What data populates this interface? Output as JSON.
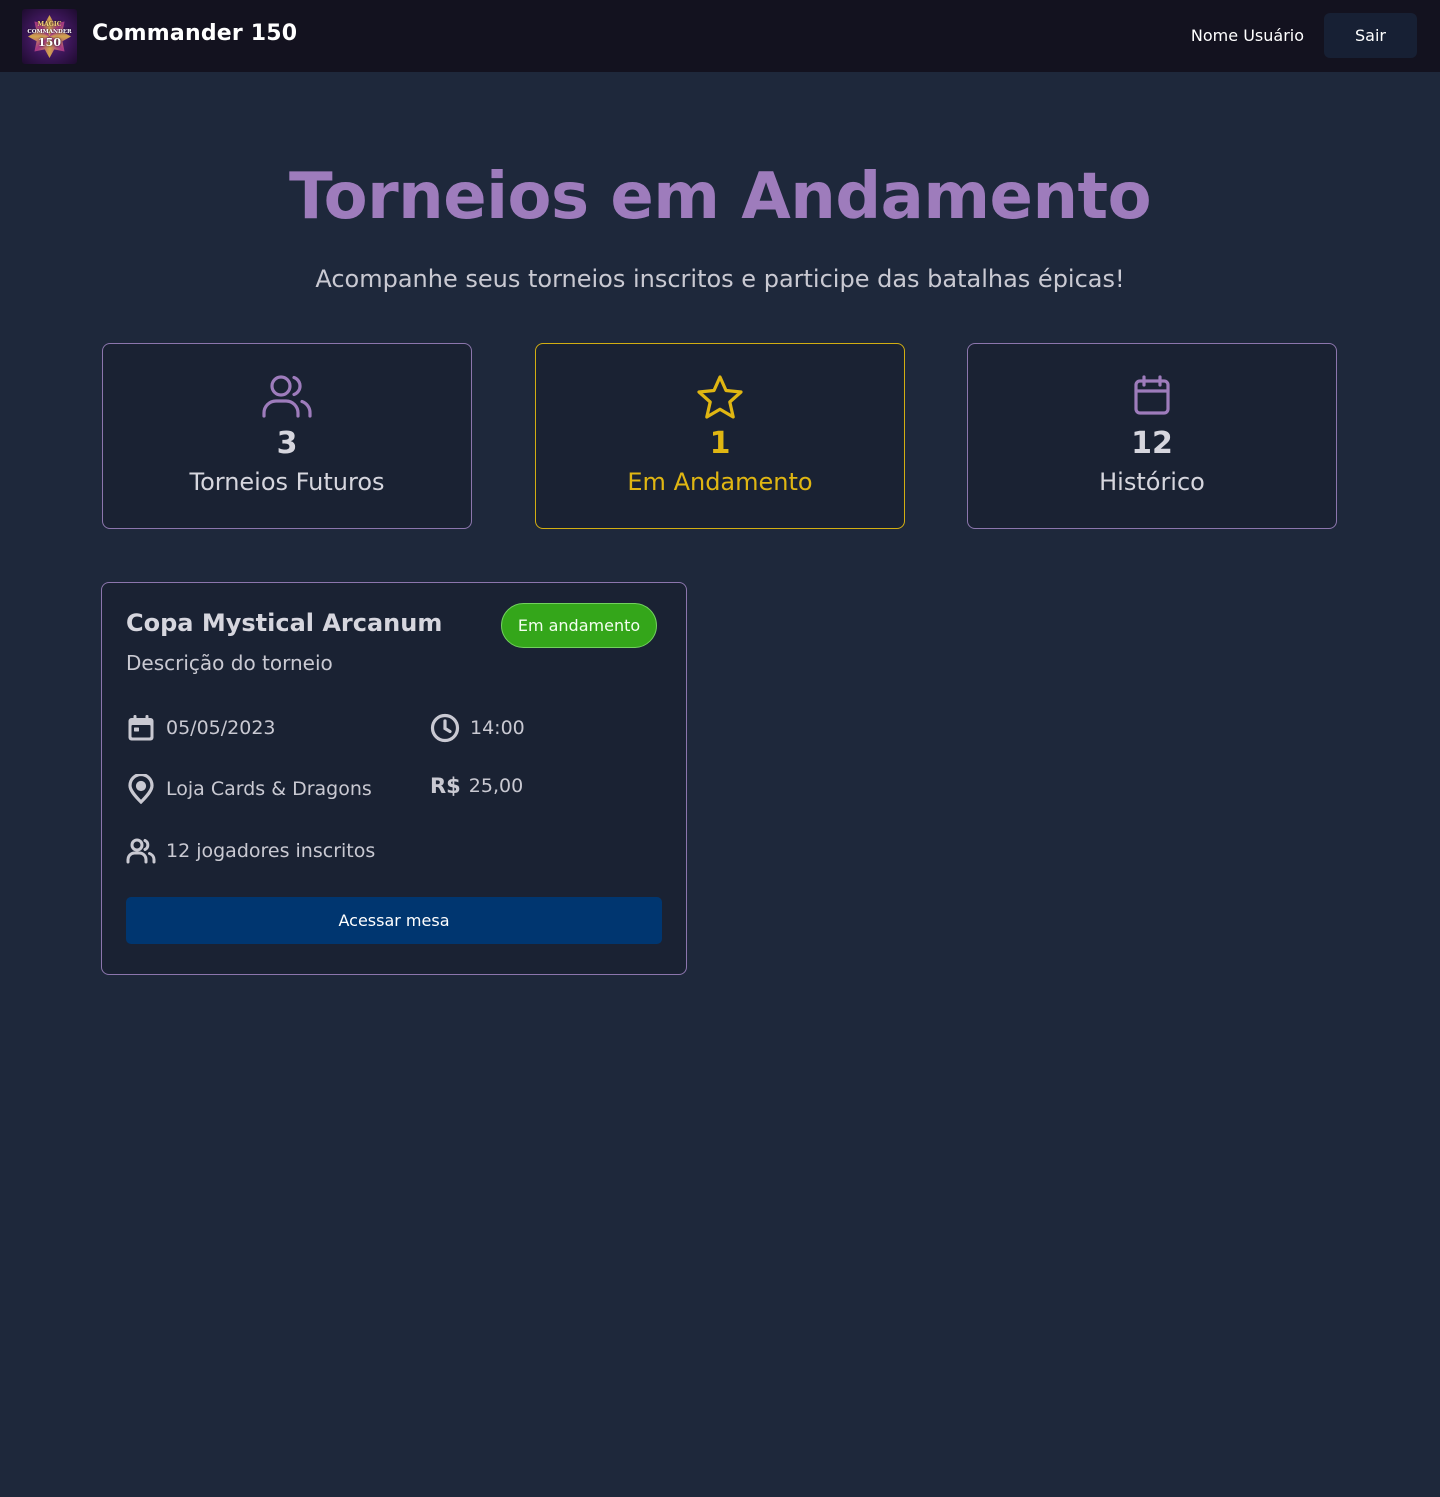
{
  "header": {
    "brand": "Commander 150",
    "logo": {
      "line1": "MAGIC",
      "line2": "COMMANDER",
      "line3": "150"
    },
    "username": "Nome Usuário",
    "logout_label": "Sair"
  },
  "hero": {
    "title": "Torneios em Andamento",
    "subtitle": "Acompanhe seus torneios inscritos e participe das batalhas épicas!"
  },
  "stats": [
    {
      "icon": "users-icon",
      "value": "3",
      "label": "Torneios Futuros"
    },
    {
      "icon": "star-icon",
      "value": "1",
      "label": "Em Andamento",
      "active": true
    },
    {
      "icon": "calendar-icon",
      "value": "12",
      "label": "Histórico"
    }
  ],
  "tournament": {
    "name": "Copa Mystical Arcanum",
    "status": "Em andamento",
    "description": "Descrição do torneio",
    "date": "05/05/2023",
    "time": "14:00",
    "location": "Loja Cards & Dragons",
    "currency": "R$",
    "price": "25,00",
    "players": "12 jogadores inscritos",
    "action_label": "Acessar mesa"
  },
  "colors": {
    "background": "#1e283b",
    "header": "#13121f",
    "accent_purple": "#9e7cbc",
    "accent_yellow": "#e0b612",
    "status_green": "#34a61a",
    "button_blue": "#003670"
  }
}
